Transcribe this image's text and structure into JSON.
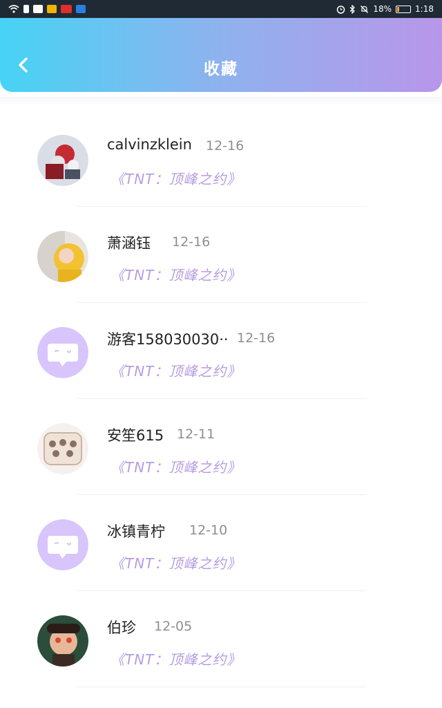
{
  "status_bar": {
    "battery": "18%",
    "time": "1:18",
    "battery_level": 0.18
  },
  "header": {
    "title": "收藏"
  },
  "favorites": [
    {
      "name": "calvinzklein",
      "date": "12-16",
      "work": "《TNT：顶峰之约》",
      "avatar": "photo-avatar-red"
    },
    {
      "name": "萧涵钰",
      "date": "12-16",
      "work": "《TNT：顶峰之约》",
      "avatar": "photo-avatar-yellow"
    },
    {
      "name": "游客158030030··",
      "date": "12-16",
      "work": "《TNT：顶峰之约》",
      "avatar": "default-chat-avatar"
    },
    {
      "name": "安笙615",
      "date": "12-11",
      "work": "《TNT：顶峰之约》",
      "avatar": "photo-avatar-group"
    },
    {
      "name": "冰镇青柠",
      "date": "12-10",
      "work": "《TNT：顶峰之约》",
      "avatar": "default-chat-avatar"
    },
    {
      "name": "伯珍",
      "date": "12-05",
      "work": "《TNT：顶峰之约》",
      "avatar": "photo-avatar-selfie"
    }
  ],
  "colors": {
    "header_gradient_start": "#46d3f5",
    "header_gradient_end": "#b896ea",
    "work_title": "#b69ce2",
    "default_avatar": "#d7c5fb"
  }
}
